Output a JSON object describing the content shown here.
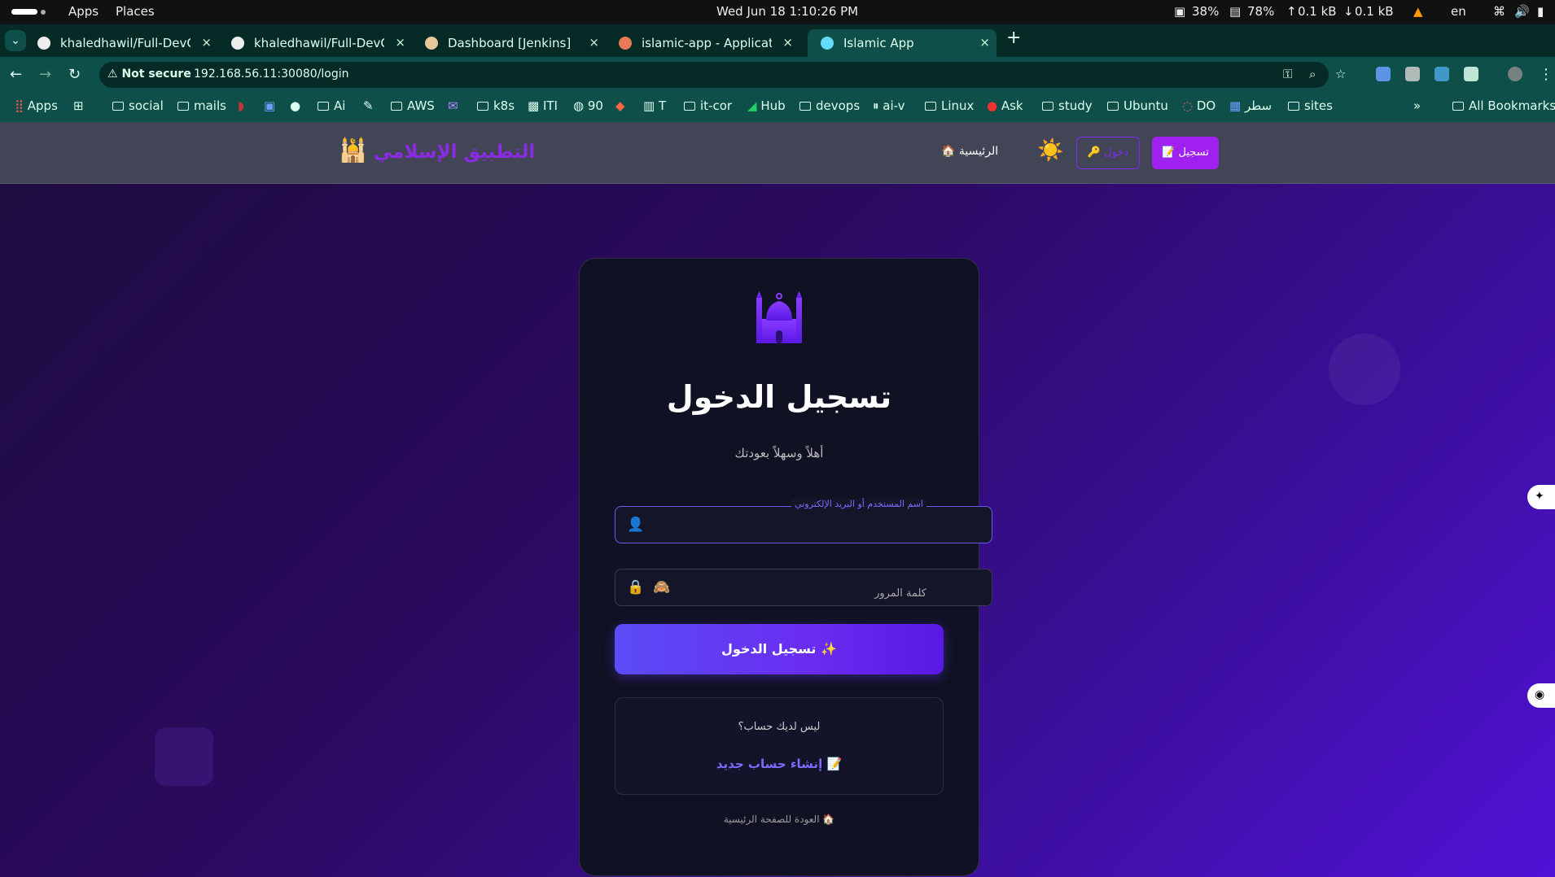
{
  "system": {
    "apps": "Apps",
    "places": "Places",
    "datetime": "Wed Jun 18    1:10:26 PM",
    "cpu": "38%",
    "mem": "78%",
    "up": "0.1 kB",
    "down": "0.1 kB",
    "lang": "en"
  },
  "tabs": [
    {
      "title": "khaledhawil/Full-DevOps",
      "close": "×"
    },
    {
      "title": "khaledhawil/Full-DevOps",
      "close": "×"
    },
    {
      "title": "Dashboard [Jenkins]",
      "close": "×"
    },
    {
      "title": "islamic-app - Application",
      "close": "×"
    },
    {
      "title": "Islamic App",
      "close": "×"
    }
  ],
  "address": {
    "not_secure": "Not secure",
    "url": "192.168.56.11:30080/login"
  },
  "bookmarks": [
    "Apps",
    "social",
    "mails",
    "Ai",
    "AWS",
    "k8s",
    "ITI",
    "90",
    "T",
    "it-cor",
    "Hub",
    "devops",
    "ai-v",
    "Linux",
    "Ask",
    "study",
    "Ubuntu",
    "DO",
    "سطر",
    "sites",
    "All Bookmarks"
  ],
  "nav": {
    "brand": "التطبيق الإسلامي",
    "brand_icon": "🕌",
    "home": "🏠 الرئيسية",
    "theme_icon": "☀️",
    "login_button": "🔑 دخول",
    "register_button": "📝 تسجيل"
  },
  "login": {
    "title": "تسجيل الدخول",
    "subtitle": "أهلاً وسهلاً بعودتك",
    "username_label": "اسم المستخدم أو البريد الإلكتروني",
    "username_icon": "👤",
    "password_placeholder": "كلمة المرور",
    "password_icon": "🔒",
    "toggle_icon": "🙈",
    "submit": "تسجيل الدخول ✨",
    "no_account": "ليس لديك حساب؟",
    "create_account": "إنشاء حساب جديد 📝",
    "back_home": "العودة للصفحة الرئيسية 🏠"
  },
  "colors": {
    "accent": "#7b2cf0",
    "brand": "#8a2be2",
    "register_bg": "#a020f0"
  }
}
